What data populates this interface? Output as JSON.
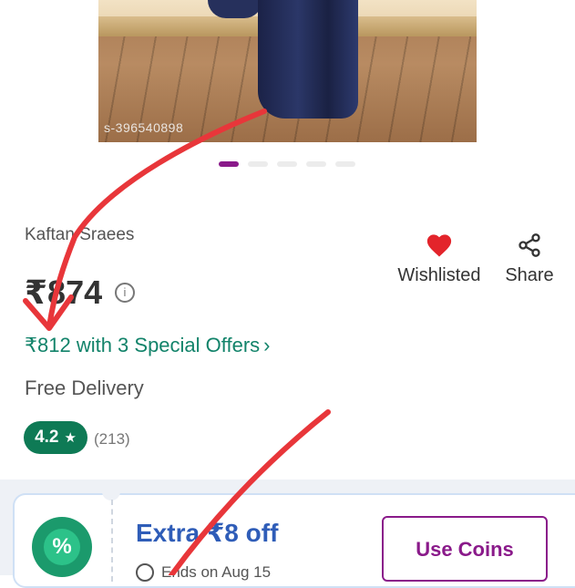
{
  "product": {
    "image_watermark": "s-396540898",
    "name": "Kaftan Sraees",
    "price": "₹874",
    "info_symbol": "i",
    "offer_text": "₹812 with 3 Special Offers",
    "offer_chevron": "›",
    "delivery": "Free Delivery",
    "rating": "4.2",
    "rating_star": "★",
    "rating_count": "(213)"
  },
  "carousel": {
    "total_dots": 5,
    "active_index": 0
  },
  "actions": {
    "wishlist_label": "Wishlisted",
    "share_label": "Share"
  },
  "coupon": {
    "icon_symbol": "%",
    "title": "Extra ₹8 off",
    "ends": "Ends on Aug 15",
    "button_label": "Use Coins"
  },
  "colors": {
    "accent_purple": "#8a1a8a",
    "offer_green": "#12836a",
    "rating_green": "#0e7a55",
    "heart_red": "#e3242b",
    "coupon_blue": "#2f5db8",
    "annotation_red": "#e8363a"
  }
}
